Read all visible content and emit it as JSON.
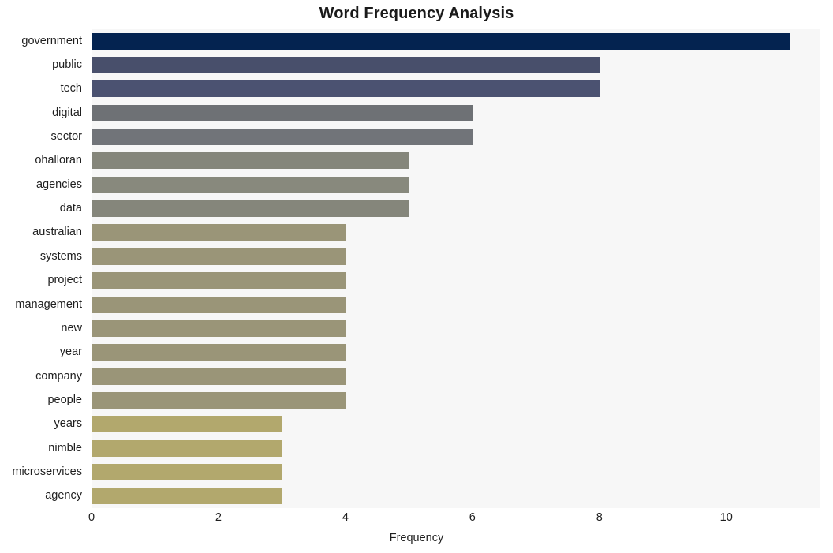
{
  "chart_data": {
    "type": "bar",
    "orientation": "horizontal",
    "title": "Word Frequency Analysis",
    "xlabel": "Frequency",
    "ylabel": "",
    "categories": [
      "government",
      "public",
      "tech",
      "digital",
      "sector",
      "ohalloran",
      "agencies",
      "data",
      "australian",
      "systems",
      "project",
      "management",
      "new",
      "year",
      "company",
      "people",
      "years",
      "nimble",
      "microservices",
      "agency"
    ],
    "values": [
      11,
      8,
      8,
      6,
      6,
      5,
      5,
      5,
      4,
      4,
      4,
      4,
      4,
      4,
      4,
      4,
      3,
      3,
      3,
      3
    ],
    "bar_colors": [
      "#042350",
      "#484f6b",
      "#4b5271",
      "#6e7175",
      "#717479",
      "#85867b",
      "#88897d",
      "#85867b",
      "#9a9578",
      "#9a9578",
      "#9a9578",
      "#9a9578",
      "#9a9578",
      "#9a9578",
      "#9a9578",
      "#9a9578",
      "#b2a86d",
      "#b2a86d",
      "#b2a86d",
      "#b2a86d"
    ],
    "xticks": [
      0,
      2,
      4,
      6,
      8,
      10
    ],
    "xtick_labels": [
      "0",
      "2",
      "4",
      "6",
      "8",
      "10"
    ],
    "xlim": [
      0,
      11.47
    ],
    "grid": true,
    "grid_axis": "x",
    "legend": false,
    "plot_background": "#f7f7f7",
    "figure_background": "#ffffff"
  }
}
